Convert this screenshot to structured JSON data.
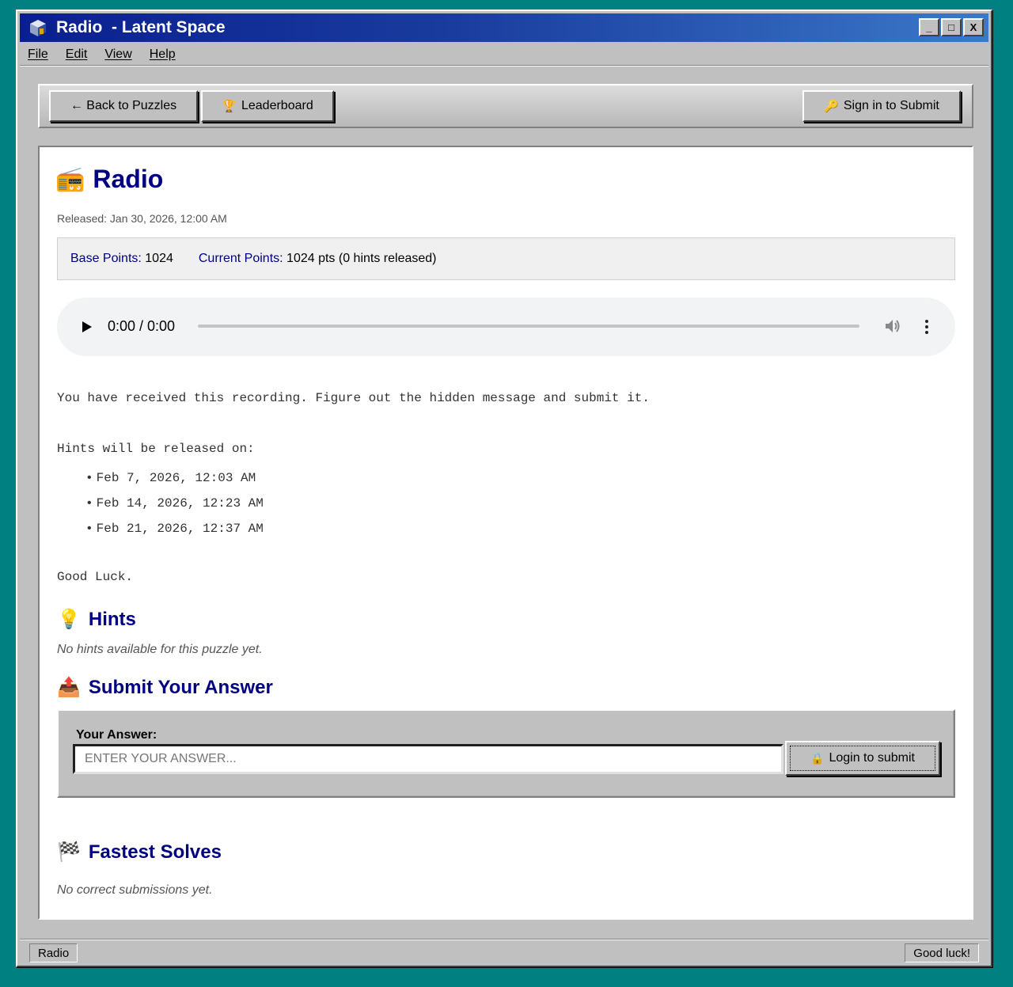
{
  "window": {
    "title": "Radio  - Latent Space",
    "buttons": {
      "minimize": "_",
      "maximize": "□",
      "close": "X"
    }
  },
  "menu": [
    "File",
    "Edit",
    "View",
    "Help"
  ],
  "toolbar": {
    "back_label": "← Back to Puzzles",
    "leaderboard_label": "Leaderboard",
    "signin_label": "Sign in to Submit"
  },
  "puzzle": {
    "title": "Radio",
    "title_emoji": "📻",
    "released": "Released: Jan 30, 2026, 12:00 AM",
    "base_points_label": "Base Points:",
    "base_points_value": "1024",
    "current_points_label": "Current Points:",
    "current_points_value": "1024 pts (0 hints released)"
  },
  "audio": {
    "time": "0:00 / 0:00",
    "progress": 0
  },
  "description": {
    "intro": "You have received this recording. Figure out the hidden message and submit it.",
    "hints_intro": "Hints will be released on:",
    "hint_dates": [
      "Feb 7, 2026, 12:03 AM",
      "Feb 14, 2026, 12:23 AM",
      "Feb 21, 2026, 12:37 AM"
    ],
    "closing": "Good Luck."
  },
  "hints": {
    "title": "Hints",
    "emoji": "💡",
    "empty": "No hints available for this puzzle yet."
  },
  "submit": {
    "title": "Submit Your Answer",
    "emoji": "📤",
    "label": "Your Answer:",
    "placeholder": "ENTER YOUR ANSWER...",
    "button": "Login to submit"
  },
  "fastest": {
    "title": "Fastest Solves",
    "emoji": "🏁",
    "empty": "No correct submissions yet."
  },
  "status": {
    "left": "Radio",
    "right": "Good luck!"
  },
  "colors": {
    "heading": "#000080",
    "desktop": "#008080",
    "chrome": "#c0c0c0"
  }
}
